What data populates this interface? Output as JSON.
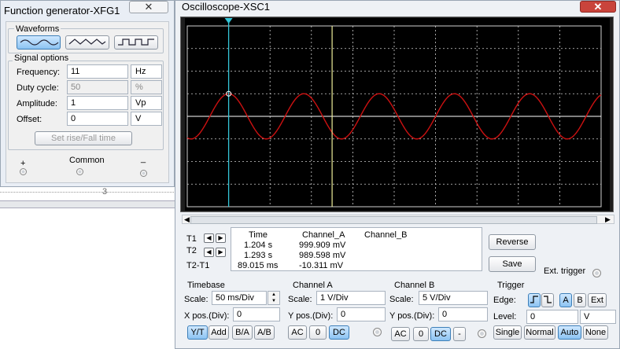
{
  "fg": {
    "title": "Function generator-XFG1",
    "waveforms_label": "Waveforms",
    "signal_options_label": "Signal options",
    "frequency": {
      "label": "Frequency:",
      "value": "11",
      "unit": "Hz"
    },
    "duty": {
      "label": "Duty cycle:",
      "value": "50",
      "unit": "%"
    },
    "amplitude": {
      "label": "Amplitude:",
      "value": "1",
      "unit": "Vp"
    },
    "offset": {
      "label": "Offset:",
      "value": "0",
      "unit": "V"
    },
    "rise_fall_label": "Set rise/Fall time",
    "plus_label": "+",
    "common_label": "Common",
    "minus_label": "_"
  },
  "bg": {
    "ruler_mark": "3"
  },
  "osc": {
    "title": "Oscilloscope-XSC1",
    "cursor_labels": {
      "t1": "T1",
      "t2": "T2",
      "t2t1": "T2-T1"
    },
    "readout": {
      "headers": [
        "Time",
        "Channel_A",
        "Channel_B"
      ],
      "rows": [
        {
          "time": "1.204 s",
          "cha": "999.909 mV",
          "chb": ""
        },
        {
          "time": "1.293 s",
          "cha": "989.598 mV",
          "chb": ""
        },
        {
          "time": "89.015 ms",
          "cha": "-10.311 mV",
          "chb": ""
        }
      ]
    },
    "reverse_label": "Reverse",
    "save_label": "Save",
    "ext_trigger_label": "Ext. trigger",
    "timebase": {
      "title": "Timebase",
      "scale_label": "Scale:",
      "scale_value": "50 ms/Div",
      "xpos_label": "X pos.(Div):",
      "xpos_value": "0",
      "modes": [
        "Y/T",
        "Add",
        "B/A",
        "A/B"
      ],
      "selected_mode": "Y/T"
    },
    "channel_a": {
      "title": "Channel A",
      "scale_label": "Scale:",
      "scale_value": "1 V/Div",
      "ypos_label": "Y pos.(Div):",
      "ypos_value": "0",
      "coupling": [
        "AC",
        "0",
        "DC"
      ],
      "selected": "DC"
    },
    "channel_b": {
      "title": "Channel B",
      "scale_label": "Scale:",
      "scale_value": "5 V/Div",
      "ypos_label": "Y pos.(Div):",
      "ypos_value": "0",
      "coupling": [
        "AC",
        "0",
        "DC",
        "-"
      ],
      "selected": "DC"
    },
    "trigger": {
      "title": "Trigger",
      "edge_label": "Edge:",
      "sources": [
        "A",
        "B",
        "Ext"
      ],
      "selected_source": "A",
      "level_label": "Level:",
      "level_value": "0",
      "level_unit": "V",
      "modes": [
        "Single",
        "Normal",
        "Auto",
        "None"
      ],
      "selected_mode": "Auto"
    },
    "signal": {
      "frequency_hz": 11,
      "amplitude_div": 1,
      "time_per_div_ms": 50,
      "cursor1_div": 1,
      "cursor2_div": 3.5
    },
    "colors": {
      "screen": "#000000",
      "grid": "#cfcfcf",
      "trace_a": "#cc1111",
      "trace_b": "#ffffff",
      "cursor1": "#35c6d8",
      "cursor2": "#eeee99"
    }
  }
}
